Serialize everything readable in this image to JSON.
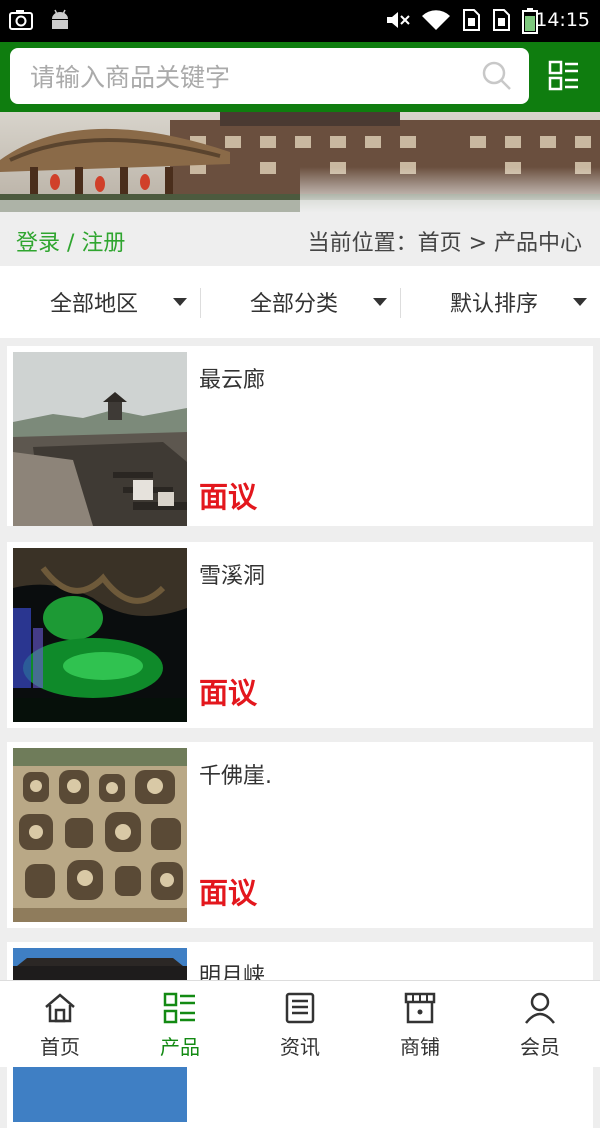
{
  "status_bar": {
    "time": "14:15",
    "icons": [
      "screenshot-icon",
      "android-icon",
      "mute-icon",
      "wifi-icon",
      "sim-icon",
      "sim-icon",
      "battery-icon"
    ]
  },
  "search": {
    "placeholder": "请输入商品关键字",
    "icon": "search-icon"
  },
  "header_menu_icon": "grid-list-icon",
  "banner_image": "scenic-pavilion-photo",
  "breadcrumb": {
    "login_text": "登录 / 注册",
    "location_text": "当前位置：首页 > 产品中心"
  },
  "filters": [
    {
      "label": "全部地区"
    },
    {
      "label": "全部分类"
    },
    {
      "label": "默认排序"
    }
  ],
  "products": [
    {
      "name": "最云廊",
      "price": "面议",
      "image": "ancient-town-photo"
    },
    {
      "name": "雪溪洞",
      "price": "面议",
      "image": "green-cave-photo"
    },
    {
      "name": "千佛崖.",
      "price": "面议",
      "image": "buddha-cliff-photo"
    },
    {
      "name": "明月峡",
      "price": "",
      "image": "gorge-gate-photo"
    }
  ],
  "bottom_nav": [
    {
      "label": "首页",
      "icon": "home-icon",
      "active": false
    },
    {
      "label": "产品",
      "icon": "product-list-icon",
      "active": true
    },
    {
      "label": "资讯",
      "icon": "news-icon",
      "active": false
    },
    {
      "label": "商铺",
      "icon": "shop-icon",
      "active": false
    },
    {
      "label": "会员",
      "icon": "member-icon",
      "active": false
    }
  ],
  "colors": {
    "header_green": "#0f7d0f",
    "login_green": "#2fa52f",
    "nav_active_green": "#138a13",
    "price_red": "#e3171d"
  }
}
